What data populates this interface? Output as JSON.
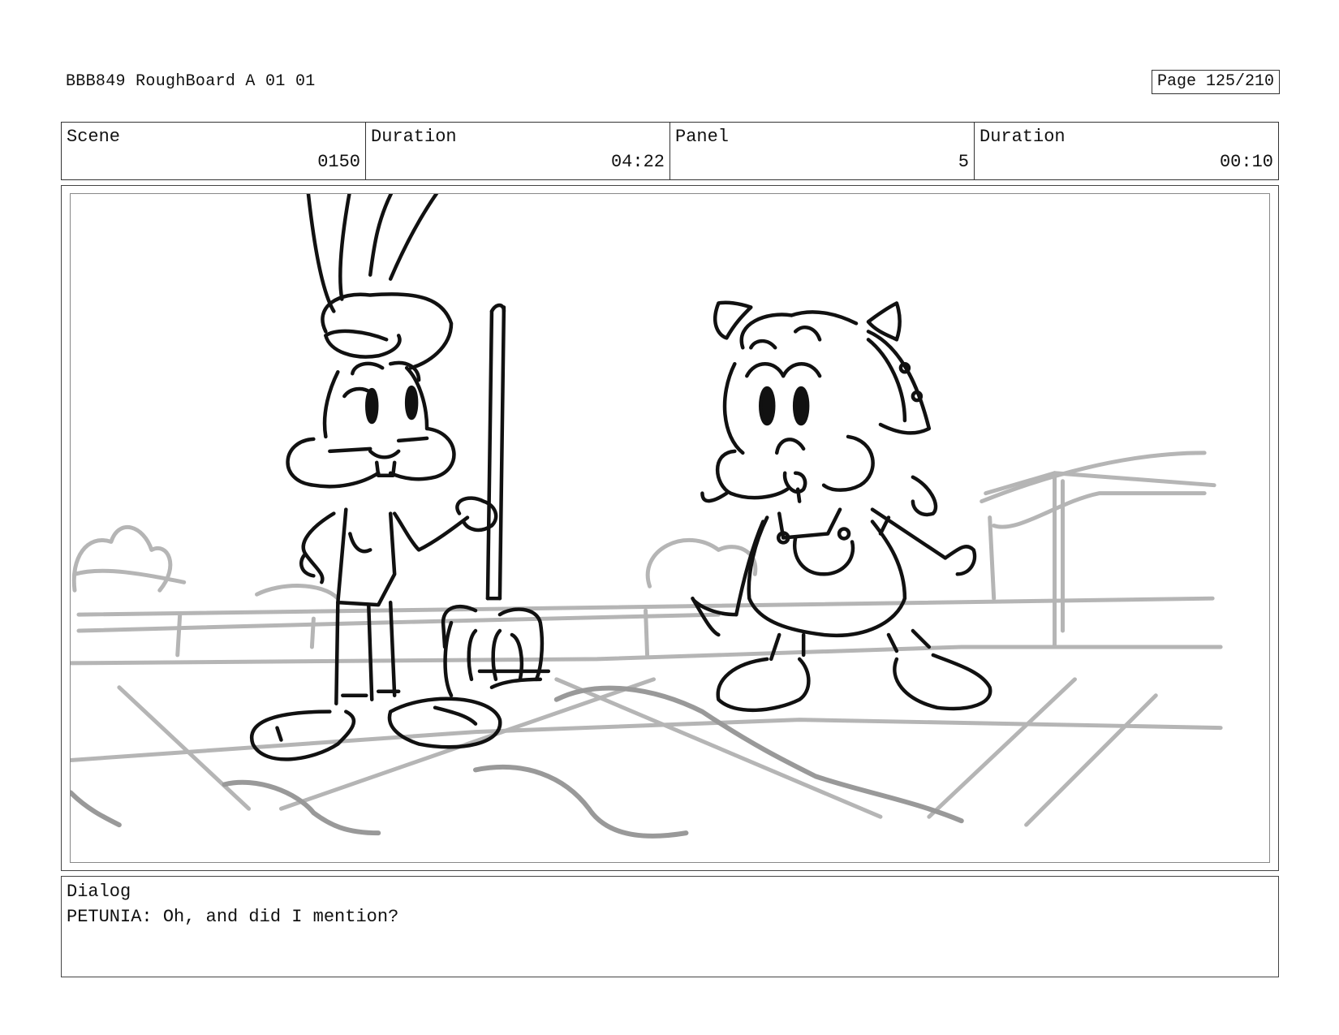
{
  "header": {
    "title": "BBB849 RoughBoard A 01 01",
    "page": "Page 125/210"
  },
  "info": {
    "scene_label": "Scene",
    "scene_value": "0150",
    "scene_duration_label": "Duration",
    "scene_duration_value": "04:22",
    "panel_label": "Panel",
    "panel_value": "5",
    "panel_duration_label": "Duration",
    "panel_duration_value": "00:10"
  },
  "dialog": {
    "label": "Dialog",
    "text": "PETUNIA: Oh, and did I mention?"
  },
  "colors": {
    "line": "#111111",
    "sketch_gray": "#b5b5b5"
  }
}
